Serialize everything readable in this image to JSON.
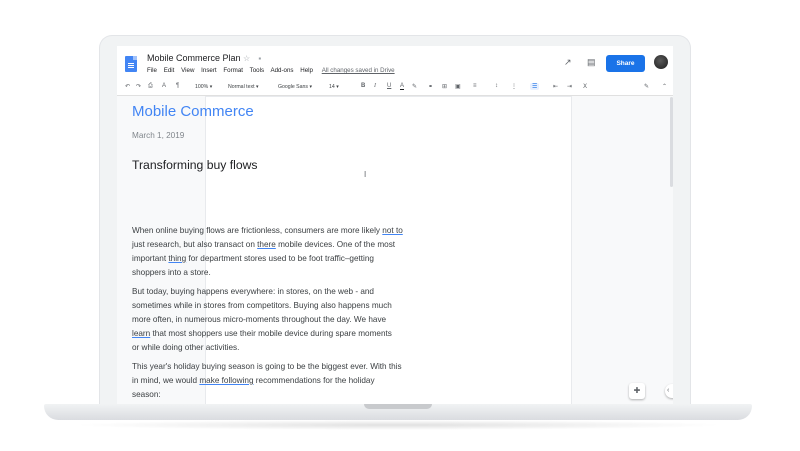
{
  "header": {
    "doc_title": "Mobile Commerce Plan",
    "star_icon": "☆",
    "folder_icon": "▪",
    "saved_status": "All changes saved in Drive",
    "share_label": "Share",
    "trend_icon": "↗",
    "comment_icon": "▤",
    "share_icon": "👤"
  },
  "menu": {
    "file": "File",
    "edit": "Edit",
    "view": "View",
    "insert": "Insert",
    "format": "Format",
    "tools": "Tools",
    "addons": "Add-ons",
    "help": "Help"
  },
  "toolbar": {
    "undo": "↶",
    "redo": "↷",
    "print": "⎙",
    "spellcheck": "A",
    "paint_format": "¶",
    "zoom": "100%",
    "style": "Normal text",
    "font": "Google Sans",
    "font_size": "14",
    "bold": "B",
    "italic": "I",
    "underline": "U",
    "text_color": "A",
    "highlight": "✎",
    "link": "⚭",
    "comment": "⊞",
    "image": "▣",
    "align": "≡",
    "line_spacing": "↕",
    "numbered_list": "⋮",
    "bulleted_list": "☰",
    "indent_less": "⇤",
    "indent_more": "⇥",
    "clear_format": "Ⅹ",
    "edit_mode": "✎",
    "collapse": "⌃",
    "dropdown": "▾"
  },
  "document": {
    "heading": "Mobile Commerce",
    "date": "March 1, 2019",
    "subheading": "Transforming buy flows",
    "para1": [
      [
        "When online buying flows are frictionless, consumers are more likely ",
        "not to"
      ],
      [
        "just research, but also transact on ",
        "there",
        " mobile devices. One of the most"
      ],
      [
        "important ",
        "thing",
        " for department stores used to be foot traffic–getting"
      ],
      [
        "shoppers into a store."
      ]
    ],
    "para2": [
      "But today, buying happens everywhere: in stores, on the web - and",
      "sometimes while in stores from competitors. Buying also happens much",
      "more often, in numerous micro-moments throughout the day. We have",
      [
        "learn",
        " that most shoppers use their mobile device during spare moments"
      ],
      "or while doing other activities."
    ],
    "para3": [
      "This year's holiday buying season is going to be the biggest ever. With this",
      [
        "in mind, we would ",
        "make following",
        " recommendations for the holiday"
      ],
      "season:"
    ]
  },
  "misc": {
    "text_cursor": "I",
    "explore_icon": "✚",
    "side_panel_icon": "‹"
  },
  "colors": {
    "accent_blue": "#1a73e8",
    "heading_blue": "#4285f4"
  }
}
